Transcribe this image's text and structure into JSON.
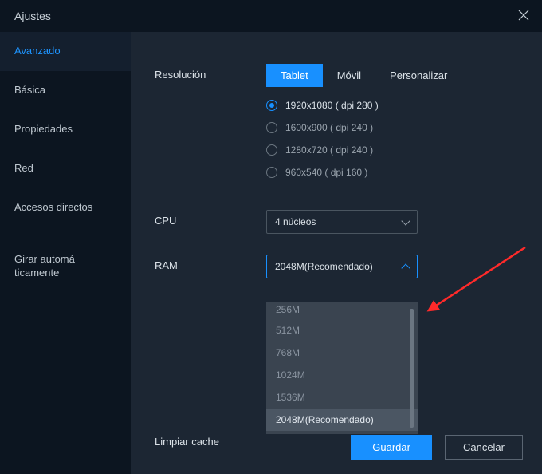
{
  "header": {
    "title": "Ajustes"
  },
  "sidebar": {
    "items": [
      {
        "label": "Avanzado",
        "active": true
      },
      {
        "label": "Básica",
        "active": false
      },
      {
        "label": "Propiedades",
        "active": false
      },
      {
        "label": "Red",
        "active": false
      },
      {
        "label": "Accesos directos",
        "active": false
      },
      {
        "label": "Girar automáticamente",
        "active": false
      }
    ]
  },
  "settings": {
    "resolution": {
      "label": "Resolución",
      "tabs": [
        {
          "label": "Tablet",
          "active": true
        },
        {
          "label": "Móvil",
          "active": false
        },
        {
          "label": "Personalizar",
          "active": false
        }
      ],
      "options": [
        {
          "label": "1920x1080 ( dpi 280 )",
          "selected": true
        },
        {
          "label": "1600x900 ( dpi 240 )",
          "selected": false
        },
        {
          "label": "1280x720 ( dpi 240 )",
          "selected": false
        },
        {
          "label": "960x540 ( dpi 160 )",
          "selected": false
        }
      ]
    },
    "cpu": {
      "label": "CPU",
      "value": "4 núcleos"
    },
    "ram": {
      "label": "RAM",
      "value": "2048M(Recomendado)",
      "options": [
        "256M",
        "512M",
        "768M",
        "1024M",
        "1536M",
        "2048M(Recomendado)"
      ],
      "open": true
    },
    "cache": {
      "label": "Limpiar cache"
    }
  },
  "footer": {
    "save": "Guardar",
    "cancel": "Cancelar"
  }
}
